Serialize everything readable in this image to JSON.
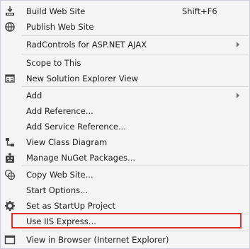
{
  "menu": {
    "items": [
      {
        "label": "Build Web Site",
        "shortcut": "Shift+F6",
        "icon": "build-icon"
      },
      {
        "label": "Publish Web Site",
        "icon": "publish-globe-icon"
      },
      {
        "label": "RadControls for ASP.NET AJAX",
        "submenu": true
      },
      {
        "label": "Scope to This"
      },
      {
        "label": "New Solution Explorer View",
        "icon": "new-view-icon"
      },
      {
        "label": "Add",
        "submenu": true
      },
      {
        "label": "Add Reference..."
      },
      {
        "label": "Add Service Reference..."
      },
      {
        "label": "View Class Diagram",
        "icon": "class-diagram-icon"
      },
      {
        "label": "Manage NuGet Packages...",
        "icon": "nuget-icon"
      },
      {
        "label": "Copy Web Site...",
        "icon": "copy-web-icon"
      },
      {
        "label": "Start Options..."
      },
      {
        "label": "Set as StartUp Project",
        "icon": "gear-icon"
      },
      {
        "label": "Use IIS Express..."
      },
      {
        "label": "View in Browser (Internet Explorer)",
        "icon": "browser-icon"
      }
    ]
  },
  "colors": {
    "highlight_border": "#e0302b",
    "menu_background": "#f5f5f5",
    "separator": "#d6d6d6"
  }
}
